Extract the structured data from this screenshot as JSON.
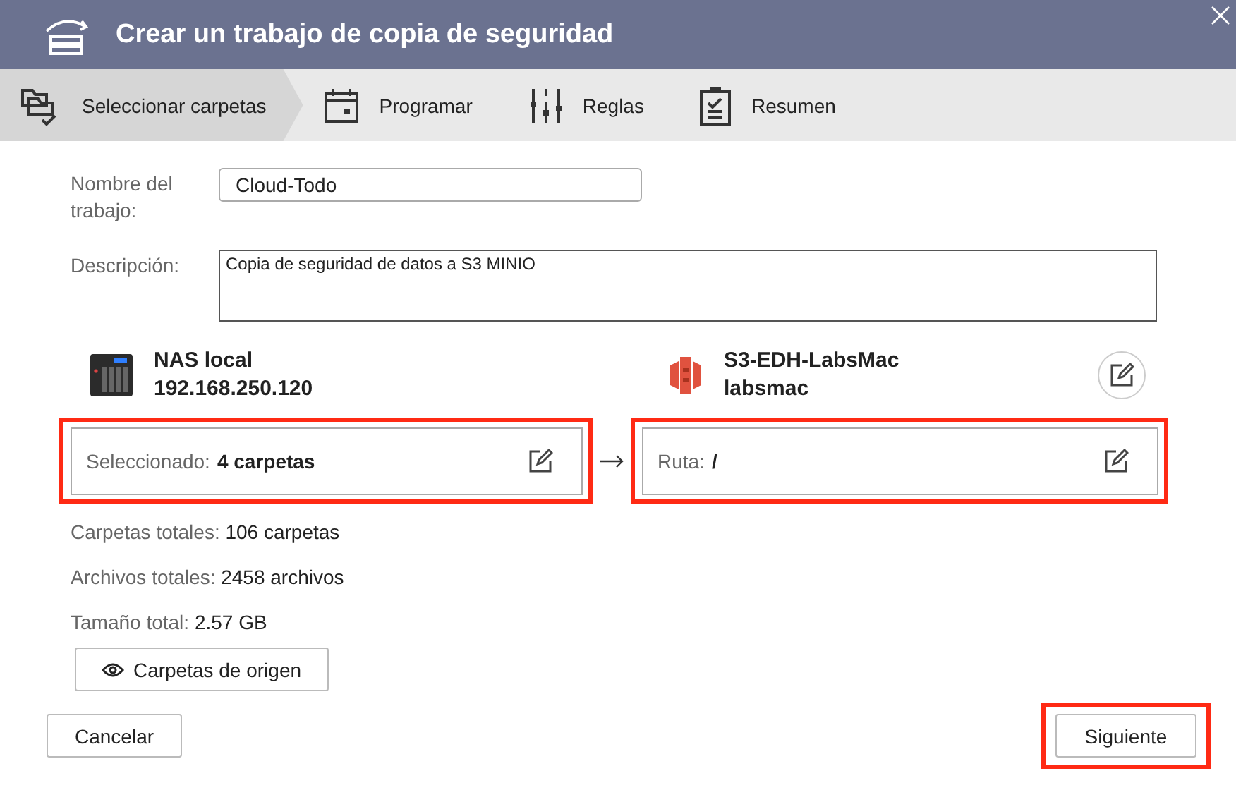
{
  "window": {
    "title": "Crear un trabajo de copia de seguridad"
  },
  "steps": [
    {
      "kind": "folders",
      "label": "Seleccionar carpetas",
      "selected": true
    },
    {
      "kind": "calendar",
      "label": "Programar",
      "selected": false
    },
    {
      "kind": "rules",
      "label": "Reglas",
      "selected": false
    },
    {
      "kind": "summary",
      "label": "Resumen",
      "selected": false
    }
  ],
  "form": [
    {
      "kind": "input",
      "label": "Nombre del trabajo:",
      "value": "Cloud-Todo"
    },
    {
      "kind": "textarea",
      "label": "Descripción:",
      "value": "Copia de seguridad de datos a S3 MINIO"
    }
  ],
  "source": {
    "name": "NAS local",
    "address": "192.168.250.120",
    "selection": {
      "label": "Seleccionado:",
      "value": "4 carpetas",
      "highlighted": true
    }
  },
  "destination": {
    "name": "S3-EDH-LabsMac",
    "account": "labsmac",
    "path": {
      "label": "Ruta:",
      "value": "/",
      "highlighted": true
    }
  },
  "stats": [
    {
      "label": "Carpetas totales:",
      "value": "106 carpetas"
    },
    {
      "label": "Archivos totales:",
      "value": "2458 archivos"
    },
    {
      "label": "Tamaño total:",
      "value": "2.57 GB"
    }
  ],
  "view_button": "Carpetas de origen",
  "buttons": [
    {
      "label": "Cancelar",
      "highlighted": false
    },
    {
      "label": "Siguiente",
      "highlighted": true
    }
  ]
}
